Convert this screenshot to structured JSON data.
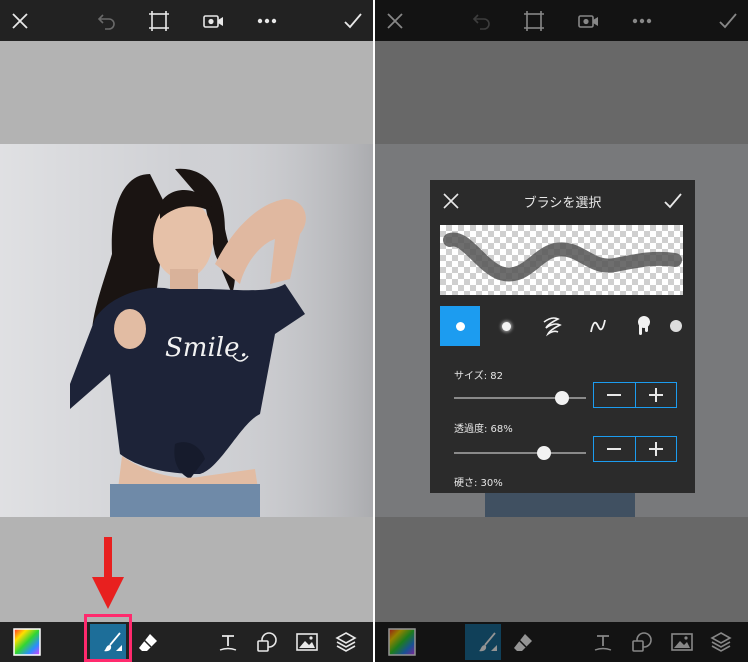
{
  "panel": {
    "title": "ブラシを選択",
    "size_label": "サイズ: 82",
    "opacity_label": "透過度: 68%",
    "hardness_label": "硬さ: 30%",
    "size_value": 82,
    "opacity_value": 68
  },
  "icons": {
    "close": "close-icon",
    "undo": "undo-icon",
    "crop": "crop-frame-icon",
    "record": "video-record-icon",
    "more": "more-dots-icon",
    "apply": "check-icon",
    "color": "color-swatch-icon",
    "brush": "brush-icon",
    "eraser": "eraser-icon",
    "text": "text-icon",
    "sticker": "sticker-icon",
    "photo": "add-photo-icon",
    "layers": "layers-icon"
  },
  "colors": {
    "accent": "#1c9cf0",
    "highlight": "#ff2a6d",
    "arrow": "#e8201f",
    "toolbar": "#222222"
  }
}
